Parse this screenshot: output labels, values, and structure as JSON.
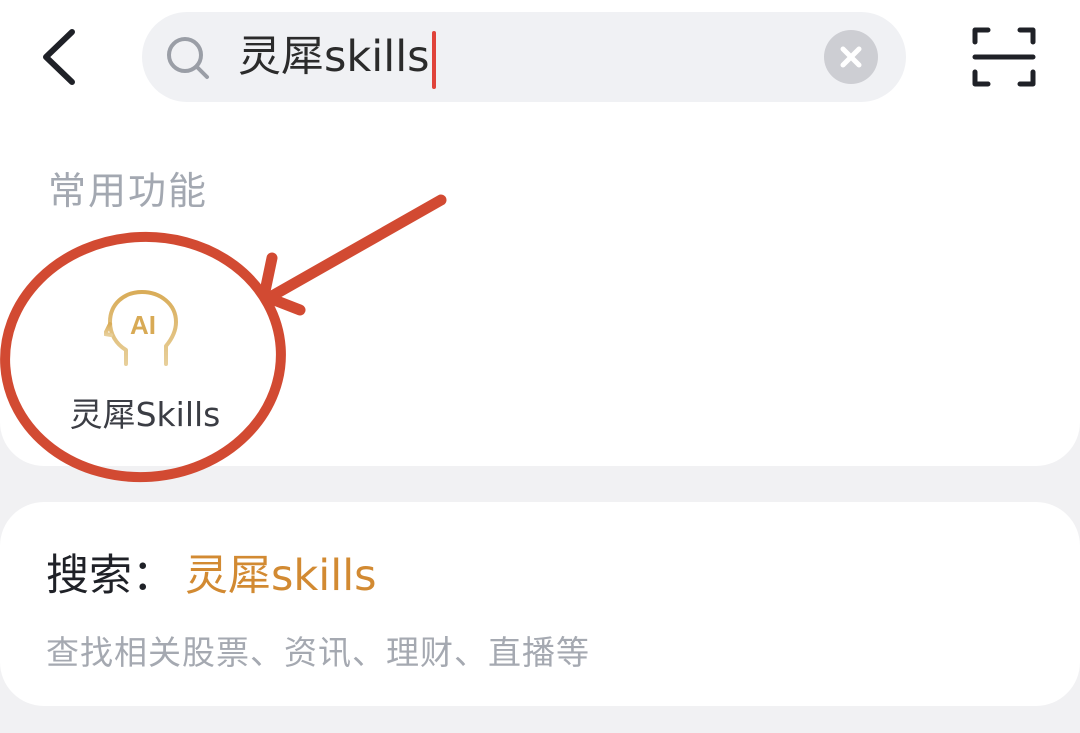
{
  "header": {
    "back_icon": "chevron-left-icon",
    "search": {
      "value": "灵犀skills",
      "search_icon": "search-icon",
      "clear_icon": "clear-circle-icon"
    },
    "scan_icon": "scan-frame-icon"
  },
  "common_functions": {
    "title": "常用功能",
    "items": [
      {
        "label": "灵犀Skills",
        "icon": "ai-head-icon",
        "icon_color": "#d9b064"
      }
    ]
  },
  "suggestion": {
    "prefix": "搜索：",
    "query": "灵犀skills",
    "description": "查找相关股票、资讯、理财、直播等"
  },
  "colors": {
    "accent": "#d28a32",
    "annotation": "#d24a32",
    "caret": "#e0433a"
  }
}
